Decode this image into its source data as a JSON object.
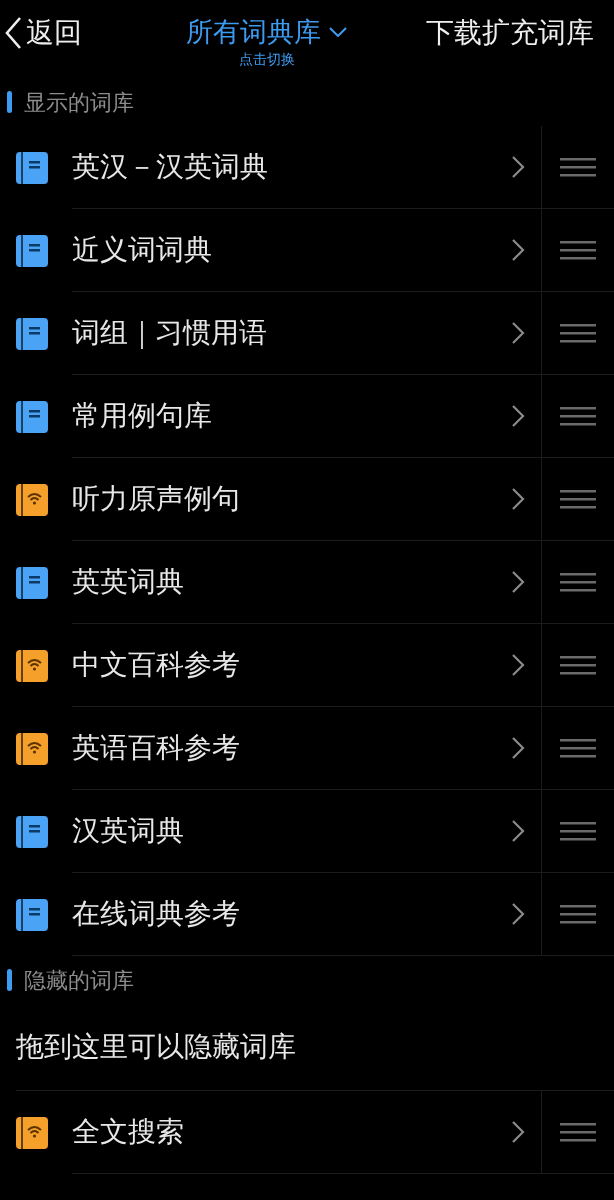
{
  "nav": {
    "back": "返回",
    "title": "所有词典库",
    "subtitle": "点击切换",
    "action": "下载扩充词库"
  },
  "sections": [
    {
      "title": "显示的词库",
      "items": [
        {
          "name": "英汉－汉英词典",
          "kind": "book"
        },
        {
          "name": "近义词词典",
          "kind": "book"
        },
        {
          "name": "词组｜习惯用语",
          "kind": "book"
        },
        {
          "name": "常用例句库",
          "kind": "book"
        },
        {
          "name": "听力原声例句",
          "kind": "online"
        },
        {
          "name": "英英词典",
          "kind": "book"
        },
        {
          "name": "中文百科参考",
          "kind": "online"
        },
        {
          "name": "英语百科参考",
          "kind": "online"
        },
        {
          "name": "汉英词典",
          "kind": "book"
        },
        {
          "name": "在线词典参考",
          "kind": "book"
        }
      ]
    },
    {
      "title": "隐藏的词库",
      "hint": "拖到这里可以隐藏词库",
      "items": [
        {
          "name": "全文搜索",
          "kind": "online"
        }
      ]
    }
  ]
}
